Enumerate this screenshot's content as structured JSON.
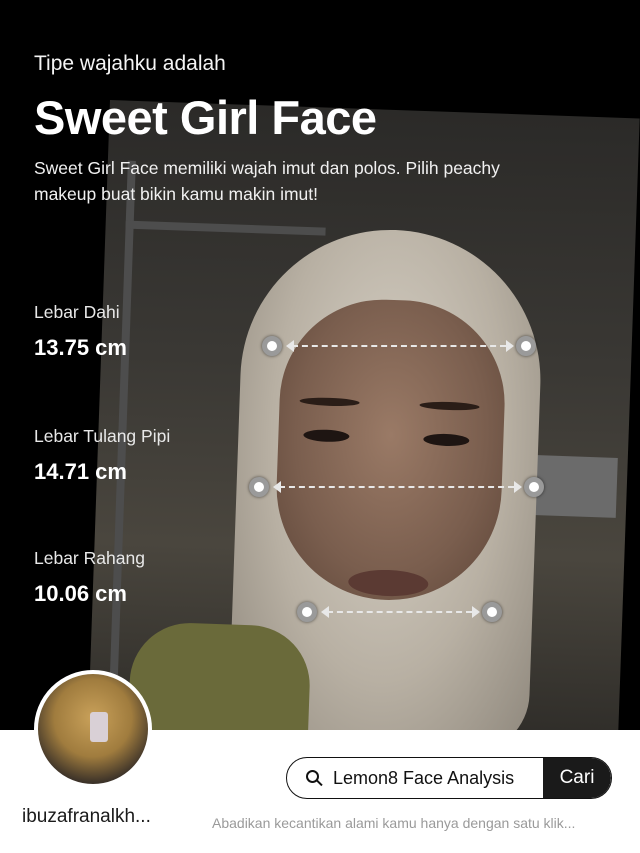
{
  "result": {
    "kicker": "Tipe wajahku adalah",
    "face_type": "Sweet Girl Face",
    "description": "Sweet Girl Face memiliki wajah imut dan polos. Pilih peachy makeup buat bikin kamu makin imut!"
  },
  "metrics": [
    {
      "label": "Lebar Dahi",
      "value": "13.75 cm"
    },
    {
      "label": "Lebar Tulang Pipi",
      "value": "14.71 cm"
    },
    {
      "label": "Lebar Rahang",
      "value": "10.06 cm"
    }
  ],
  "footer": {
    "username": "ibuzafranalkh...",
    "search_query": "Lemon8 Face Analysis",
    "search_button": "Cari",
    "tagline": "Abadikan kecantikan alami kamu hanya dengan satu klik..."
  },
  "icons": {
    "search": "search-icon",
    "measure_handle": "circle-handle-icon"
  },
  "colors": {
    "background": "#000000",
    "footer": "#ffffff",
    "button": "#1a1a1a"
  }
}
